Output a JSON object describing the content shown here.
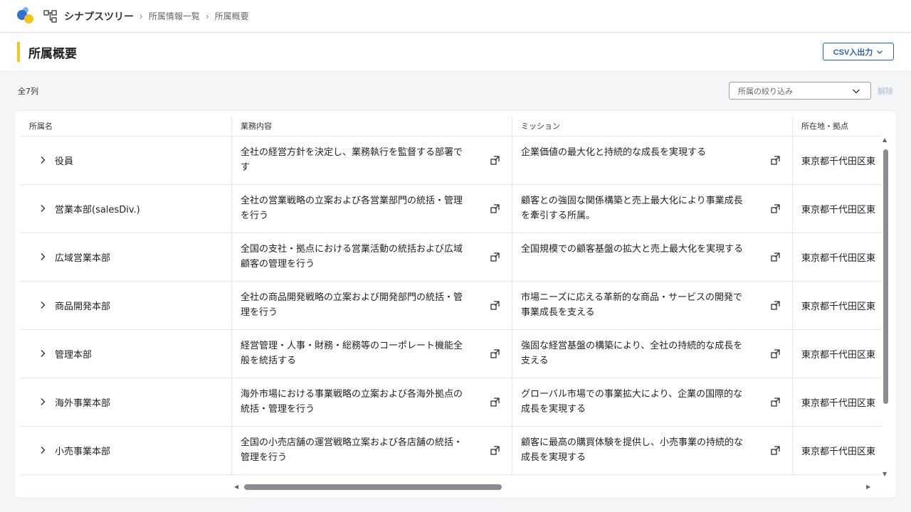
{
  "header": {
    "app_name": "シナプスツリー",
    "breadcrumbs": [
      "所属情報一覧",
      "所属概要"
    ]
  },
  "page": {
    "title": "所属概要",
    "csv_button": "CSV入出力",
    "count_label": "全7列",
    "filter_placeholder": "所属の絞り込み",
    "clear_label": "解除"
  },
  "table": {
    "columns": [
      "所属名",
      "業務内容",
      "ミッション",
      "所在地・拠点"
    ],
    "rows": [
      {
        "name": "役員",
        "business": "全社の経営方針を決定し、業務執行を監督する部署です",
        "mission": "企業価値の最大化と持続的な成長を実現する",
        "location": "東京都千代田区東"
      },
      {
        "name": "営業本部(salesDiv.)",
        "business": "全社の営業戦略の立案および各営業部門の統括・管理を行う",
        "mission": "顧客との強固な関係構築と売上最大化により事業成長を牽引する所属。",
        "location": "東京都千代田区東"
      },
      {
        "name": "広域営業本部",
        "business": "全国の支社・拠点における営業活動の統括および広域顧客の管理を行う",
        "mission": "全国規模での顧客基盤の拡大と売上最大化を実現する",
        "location": "東京都千代田区東"
      },
      {
        "name": "商品開発本部",
        "business": "全社の商品開発戦略の立案および開発部門の統括・管理を行う",
        "mission": "市場ニーズに応える革新的な商品・サービスの開発で事業成長を支える",
        "location": "東京都千代田区東"
      },
      {
        "name": "管理本部",
        "business": "経営管理・人事・財務・総務等のコーポレート機能全般を統括する",
        "mission": "強固な経営基盤の構築により、全社の持続的な成長を支える",
        "location": "東京都千代田区東"
      },
      {
        "name": "海外事業本部",
        "business": "海外市場における事業戦略の立案および各海外拠点の統括・管理を行う",
        "mission": "グローバル市場での事業拡大により、企業の国際的な成長を実現する",
        "location": "東京都千代田区東"
      },
      {
        "name": "小売事業本部",
        "business": "全国の小売店舗の運営戦略立案および各店舗の統括・管理を行う",
        "mission": "顧客に最高の購買体験を提供し、小売事業の持続的な成長を実現する",
        "location": "東京都千代田区東"
      }
    ]
  },
  "icons": {
    "expand": "chevron-right-icon",
    "open_detail": "external-link-icon",
    "dropdown": "chevron-down-icon"
  },
  "colors": {
    "accent": "#f5c518",
    "primary": "#2f5fb3",
    "scrollbar": "#8a8d92"
  }
}
